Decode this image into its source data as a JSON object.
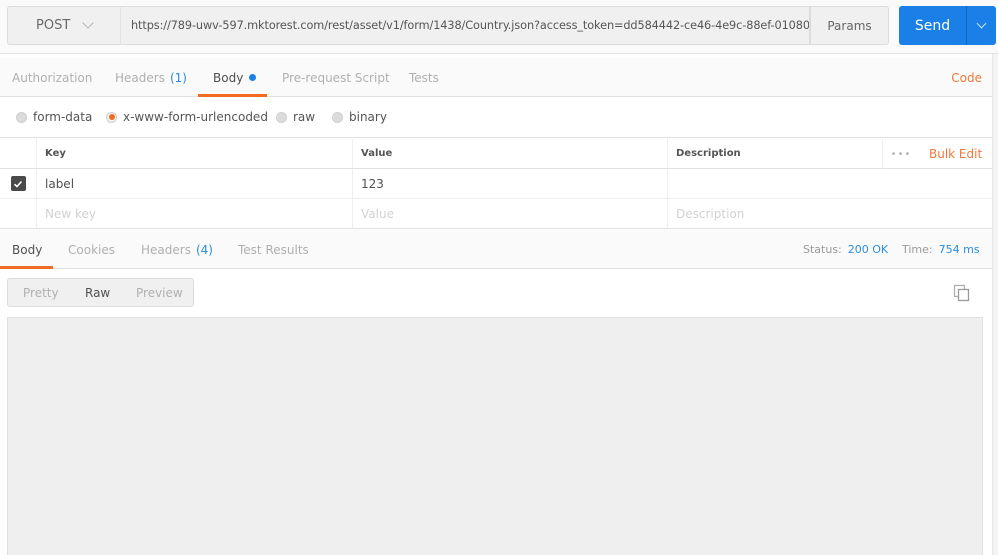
{
  "request": {
    "method": "POST",
    "url": "https://789-uwv-597.mktorest.com/rest/asset/v1/form/1438/Country.json?access_token=dd584442-ce46-4e9c-88ef-01080...",
    "params_label": "Params",
    "send_label": "Send"
  },
  "request_tabs": [
    {
      "label": "Authorization",
      "count": null,
      "active": false
    },
    {
      "label": "Headers",
      "count": "(1)",
      "active": false
    },
    {
      "label": "Body",
      "count": null,
      "active": true,
      "dot": true
    },
    {
      "label": "Pre-request Script",
      "count": null,
      "active": false
    },
    {
      "label": "Tests",
      "count": null,
      "active": false
    }
  ],
  "code_label": "Code",
  "body_types": [
    {
      "label": "form-data",
      "selected": false
    },
    {
      "label": "x-www-form-urlencoded",
      "selected": true
    },
    {
      "label": "raw",
      "selected": false
    },
    {
      "label": "binary",
      "selected": false
    }
  ],
  "params_table": {
    "headers": {
      "key": "Key",
      "value": "Value",
      "description": "Description"
    },
    "bulk_edit_label": "Bulk Edit",
    "more_label": "•••",
    "rows": [
      {
        "checked": true,
        "key": "label",
        "value": "123",
        "description": ""
      }
    ],
    "new_row": {
      "key_placeholder": "New key",
      "value_placeholder": "Value",
      "description_placeholder": "Description"
    }
  },
  "response_tabs": [
    {
      "label": "Body",
      "count": null,
      "active": true
    },
    {
      "label": "Cookies",
      "count": null,
      "active": false
    },
    {
      "label": "Headers",
      "count": "(4)",
      "active": false
    },
    {
      "label": "Test Results",
      "count": null,
      "active": false
    }
  ],
  "response_status": {
    "status_label": "Status:",
    "status_value": "200 OK",
    "time_label": "Time:",
    "time_value": "754 ms"
  },
  "view_modes": [
    {
      "label": "Pretty",
      "active": false
    },
    {
      "label": "Raw",
      "active": true
    },
    {
      "label": "Preview",
      "active": false
    }
  ],
  "colors": {
    "accent_orange": "#f26b22",
    "send_blue": "#1a7fe6",
    "link_blue": "#2b8de0"
  }
}
